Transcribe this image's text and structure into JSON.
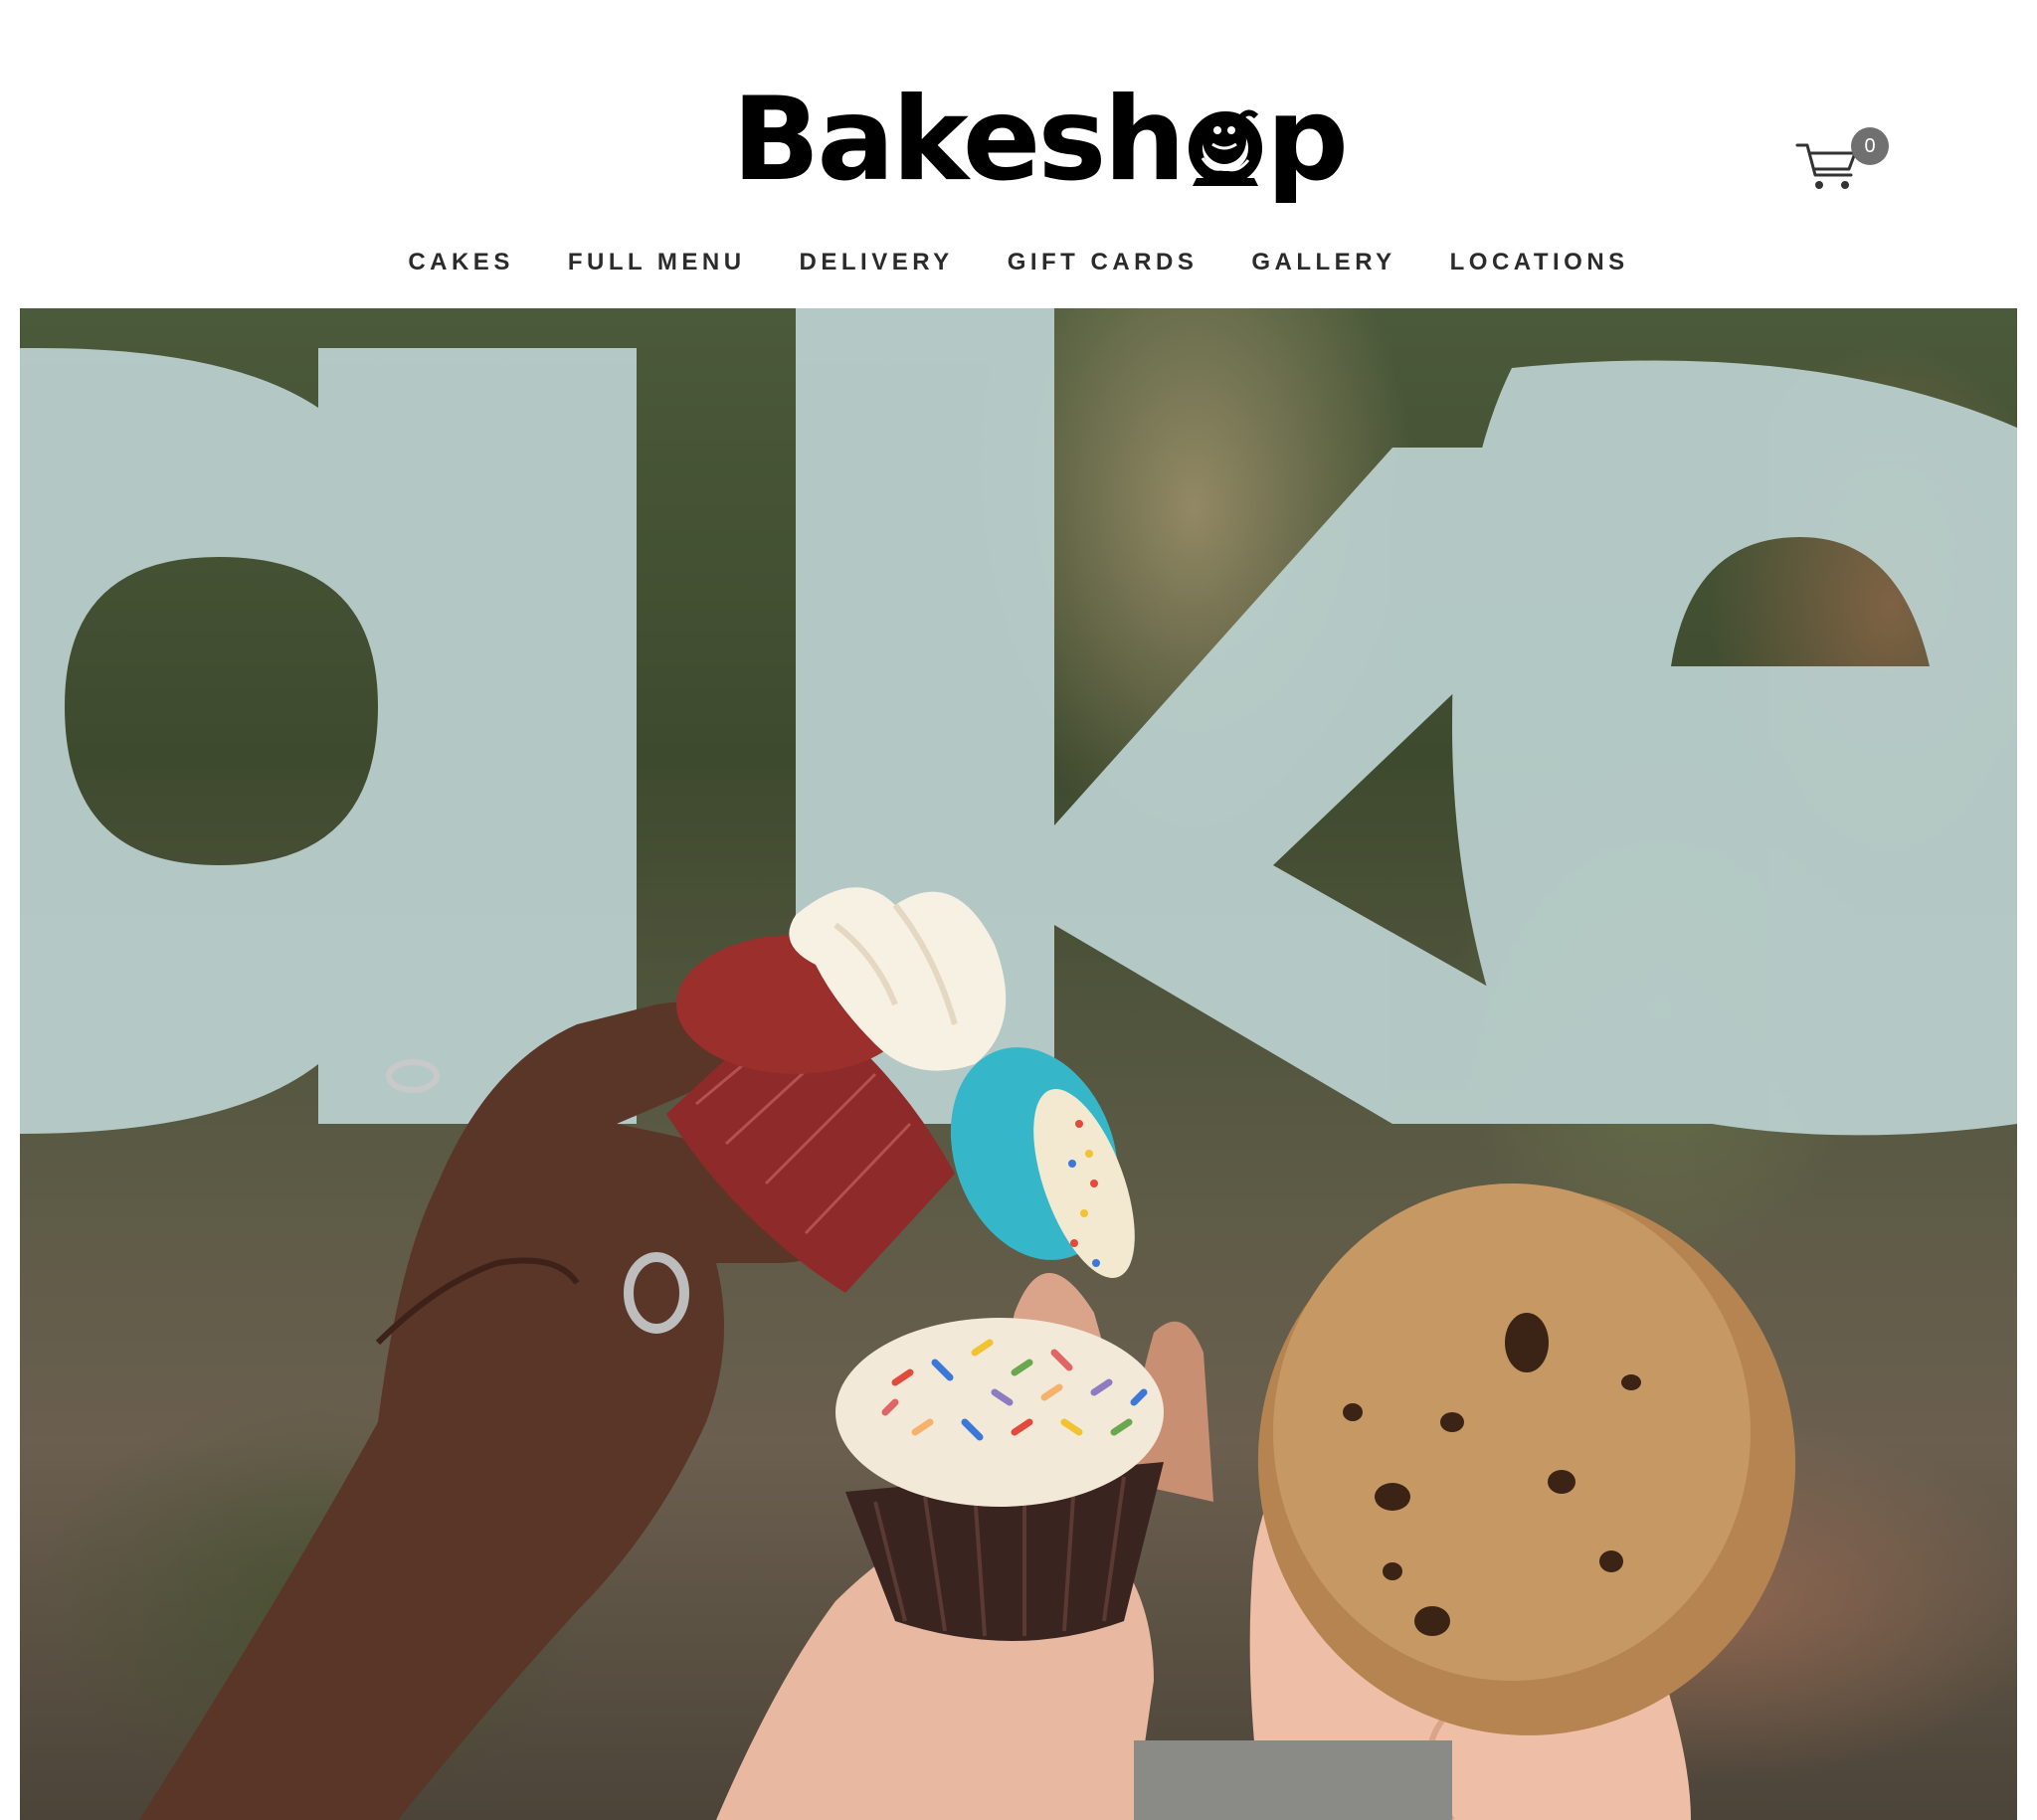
{
  "brand": {
    "logo_text_left": "Bakesh",
    "logo_text_right": "p",
    "logo_mascot_icon": "gorilla-mascot-icon"
  },
  "cart": {
    "icon": "shopping-cart-icon",
    "count": "0"
  },
  "nav": {
    "items": [
      {
        "label": "CAKES"
      },
      {
        "label": "FULL MENU"
      },
      {
        "label": "DELIVERY"
      },
      {
        "label": "GIFT CARDS"
      },
      {
        "label": "GALLERY"
      },
      {
        "label": "LOCATIONS"
      }
    ]
  },
  "hero": {
    "window_lettering": "ake",
    "colors": {
      "lettering": "#b9cfcc",
      "background": "#4b5a3a"
    }
  }
}
